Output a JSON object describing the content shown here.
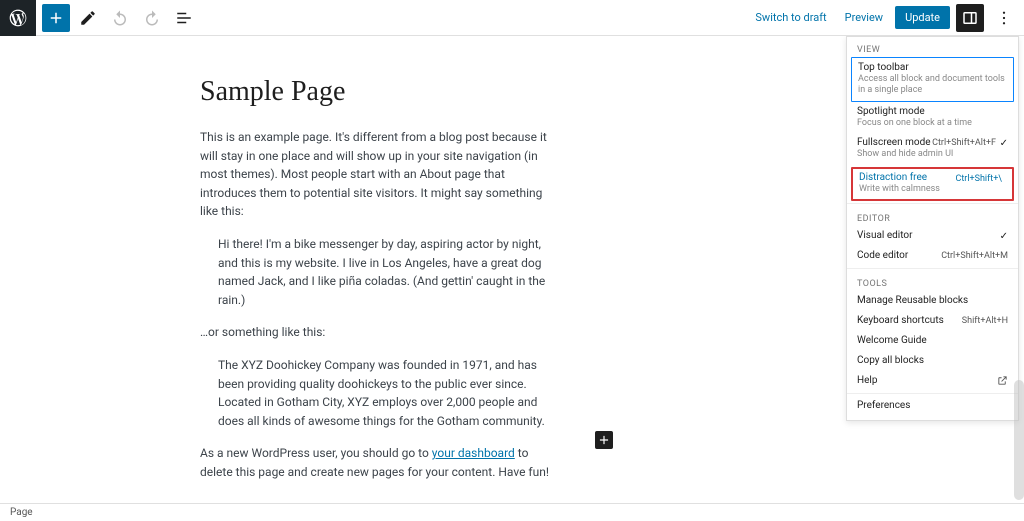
{
  "topbar": {
    "switch_to_draft": "Switch to draft",
    "preview": "Preview",
    "update": "Update"
  },
  "content": {
    "title": "Sample Page",
    "p1": "This is an example page. It's different from a blog post because it will stay in one place and will show up in your site navigation (in most themes). Most people start with an About page that introduces them to potential site visitors. It might say something like this:",
    "q1": "Hi there! I'm a bike messenger by day, aspiring actor by night, and this is my website. I live in Los Angeles, have a great dog named Jack, and I like piña coladas. (And gettin' caught in the rain.)",
    "p2": "…or something like this:",
    "q2": "The XYZ Doohickey Company was founded in 1971, and has been providing quality doohickeys to the public ever since. Located in Gotham City, XYZ employs over 2,000 people and does all kinds of awesome things for the Gotham community.",
    "p3a": "As a new WordPress user, you should go to ",
    "p3_link": "your dashboard",
    "p3b": " to delete this page and create new pages for your content. Have fun!"
  },
  "panel": {
    "view_label": "VIEW",
    "top_toolbar": {
      "label": "Top toolbar",
      "sub": "Access all block and document tools in a single place"
    },
    "spotlight": {
      "label": "Spotlight mode",
      "sub": "Focus on one block at a time"
    },
    "fullscreen": {
      "label": "Fullscreen mode",
      "sub": "Show and hide admin UI",
      "shortcut": "Ctrl+Shift+Alt+F"
    },
    "distraction": {
      "label": "Distraction free",
      "sub": "Write with calmness",
      "shortcut": "Ctrl+Shift+\\"
    },
    "editor_label": "EDITOR",
    "visual": {
      "label": "Visual editor"
    },
    "code": {
      "label": "Code editor",
      "shortcut": "Ctrl+Shift+Alt+M"
    },
    "tools_label": "TOOLS",
    "reusable": {
      "label": "Manage Reusable blocks"
    },
    "shortcuts": {
      "label": "Keyboard shortcuts",
      "shortcut": "Shift+Alt+H"
    },
    "welcome": {
      "label": "Welcome Guide"
    },
    "copy": {
      "label": "Copy all blocks"
    },
    "help": {
      "label": "Help"
    },
    "prefs": {
      "label": "Preferences"
    }
  },
  "footer": {
    "breadcrumb": "Page"
  }
}
